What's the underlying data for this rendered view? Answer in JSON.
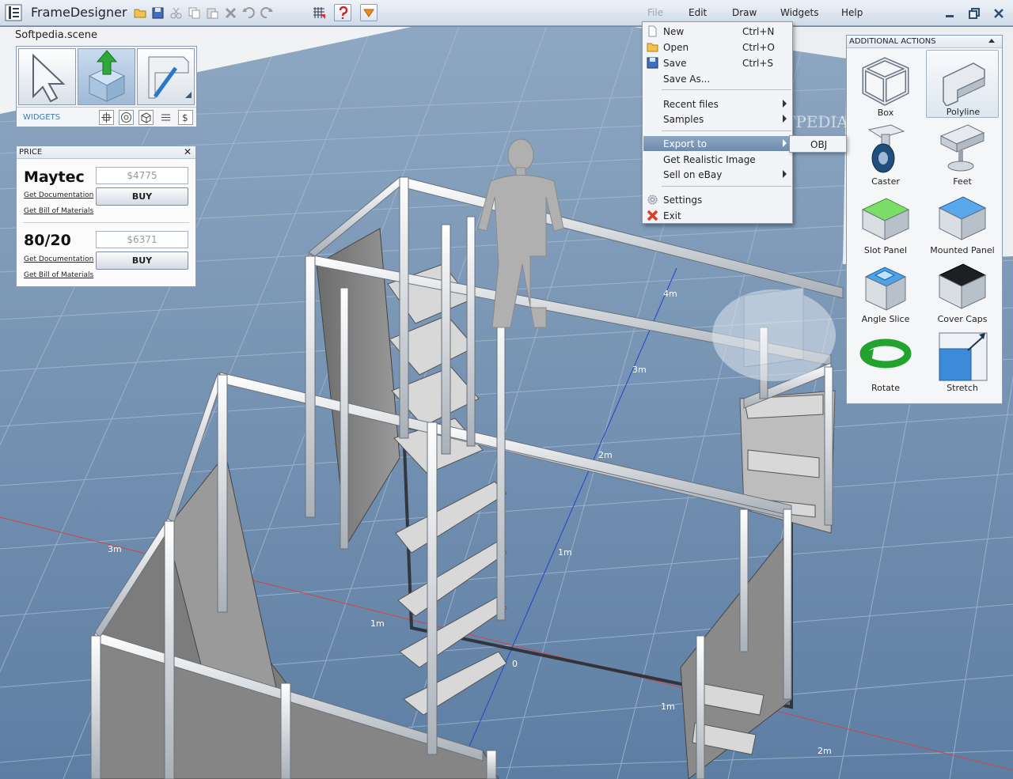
{
  "app": {
    "title": "FrameDesigner",
    "scene_name": "Softpedia.scene"
  },
  "toolbar": {
    "buttons": [
      "open-icon",
      "save-icon",
      "cut-icon",
      "copy-icon",
      "paste-icon",
      "delete-icon",
      "undo-icon",
      "redo-icon",
      "grid-icon",
      "help-icon",
      "dropdown-icon"
    ]
  },
  "menubar": {
    "items": [
      "File",
      "Edit",
      "Draw",
      "Widgets",
      "Help"
    ]
  },
  "tools": {
    "widgets_label": "WIDGETS",
    "big_tools": [
      "select-pointer-icon",
      "extrude-profile-icon",
      "draw-profile-icon"
    ],
    "widget_icons": [
      "move-widget-icon",
      "rotate-widget-icon",
      "box-widget-icon",
      "list-widget-icon",
      "price-widget-icon"
    ]
  },
  "price": {
    "title": "PRICE",
    "close": "✕",
    "vendors": [
      {
        "name": "Maytec",
        "price": "$4775",
        "buy": "BUY",
        "doc": "Get Documentation",
        "bom": "Get Bill of Materials"
      },
      {
        "name": "80/20",
        "price": "$6371",
        "buy": "BUY",
        "doc": "Get Documentation",
        "bom": "Get Bill of Materials"
      }
    ]
  },
  "file_menu": {
    "items": [
      {
        "label": "New",
        "shortcut": "Ctrl+N"
      },
      {
        "label": "Open",
        "shortcut": "Ctrl+O"
      },
      {
        "label": "Save",
        "shortcut": "Ctrl+S"
      },
      {
        "label": "Save As..."
      },
      {
        "label": "Recent files"
      },
      {
        "label": "Samples"
      },
      {
        "label": "Export to"
      },
      {
        "label": "Get Realistic Image"
      },
      {
        "label": "Sell on eBay"
      },
      {
        "label": "Settings"
      },
      {
        "label": "Exit"
      }
    ],
    "export_submenu": [
      "OBJ"
    ]
  },
  "additional_actions": {
    "title": "ADDITIONAL ACTIONS",
    "items": [
      "Box",
      "Polyline",
      "Caster",
      "Feet",
      "Slot Panel",
      "Mounted Panel",
      "Angle Slice",
      "Cover Caps",
      "Rotate",
      "Stretch"
    ]
  },
  "viewport": {
    "dimension_labels": [
      "4m",
      "3m",
      "2m",
      "1m",
      "0",
      "3m",
      "1m",
      "1m",
      "2m"
    ],
    "watermark": "SOFTPEDIA"
  }
}
